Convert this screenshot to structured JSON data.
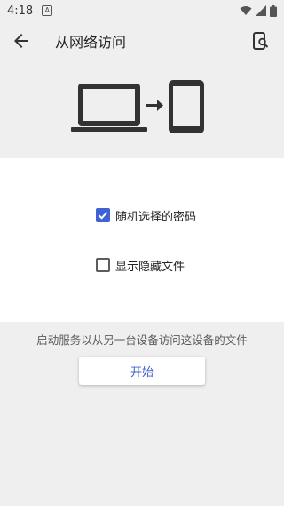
{
  "status_bar": {
    "time": "4:18",
    "app_icon_letter": "A",
    "icons": [
      "wifi-icon",
      "signal-icon",
      "battery-icon"
    ]
  },
  "app_bar": {
    "title": "从网络访问",
    "back_icon": "arrow-left-icon",
    "action_icon": "phone-search-icon"
  },
  "hero": {
    "icons": [
      "laptop-icon",
      "arrow-right-icon",
      "smartphone-icon"
    ]
  },
  "options": [
    {
      "label": "随机选择的密码",
      "checked": true
    },
    {
      "label": "显示隐藏文件",
      "checked": false
    }
  ],
  "footer": {
    "hint": "启动服务以从另一台设备访问这设备的文件",
    "start_label": "开始"
  },
  "colors": {
    "accent": "#3f63d6",
    "background": "#efefef",
    "panel": "#ffffff"
  }
}
